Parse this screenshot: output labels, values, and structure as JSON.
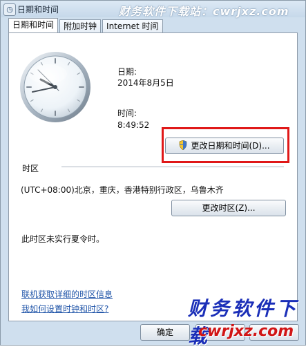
{
  "window": {
    "title": "日期和时间",
    "watermark_top": "财务软件下载站：cwrjxz.com",
    "watermark_bottom_line1": "财务软件下载",
    "watermark_bottom_line2": "cwrjxz.com"
  },
  "tabs": [
    {
      "label": "日期和时间",
      "active": true
    },
    {
      "label": "附加时钟",
      "active": false
    },
    {
      "label": "Internet 时间",
      "active": false
    }
  ],
  "datetime": {
    "date_label": "日期:",
    "date_value": "2014年8月5日",
    "time_label": "时间:",
    "time_value": "8:49:52",
    "change_button": "更改日期和时间(D)..."
  },
  "timezone": {
    "section_label": "时区",
    "value": "(UTC+08:00)北京，重庆，香港特别行政区，乌鲁木齐",
    "change_button": "更改时区(Z)...",
    "dst_note": "此时区未实行夏令时。"
  },
  "links": {
    "online_info": "联机获取详细的时区信息",
    "how_to_set": "我如何设置时钟和时区?"
  },
  "footer": {
    "ok": "确定"
  },
  "icons": {
    "window_icon": "clock-calendar-icon",
    "shield": "uac-shield-icon"
  }
}
